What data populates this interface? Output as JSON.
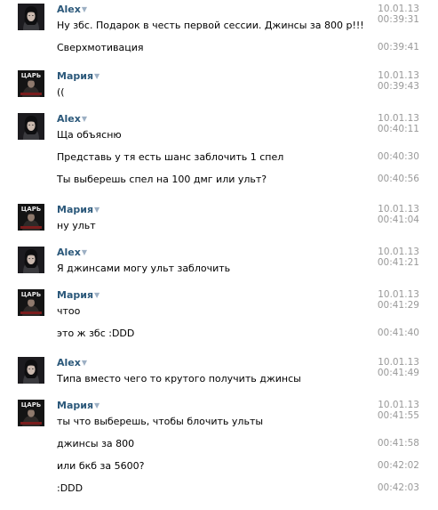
{
  "users": {
    "alex": "Alex",
    "maria": "Мария"
  },
  "avatars": {
    "maria_caption": "ЦАРЬ"
  },
  "colors": {
    "author_link": "#2b587a",
    "timestamp": "#999999"
  },
  "groups": [
    {
      "author": "Alex",
      "avatar": "alex",
      "date": "10.01.13",
      "lines": [
        {
          "text": "Ну збс. Подарок в честь первой сессии. Джинсы за 800 р!!!",
          "time": "00:39:31"
        },
        {
          "text": "Сверхмотивация",
          "time": "00:39:41"
        }
      ]
    },
    {
      "author": "Мария",
      "avatar": "maria",
      "date": "10.01.13",
      "lines": [
        {
          "text": "((",
          "time": "00:39:43"
        }
      ]
    },
    {
      "author": "Alex",
      "avatar": "alex",
      "date": "10.01.13",
      "lines": [
        {
          "text": "Ща объясню",
          "time": "00:40:11"
        },
        {
          "text": "Представь у тя есть шанс заблочить 1 спел",
          "time": "00:40:30"
        },
        {
          "text": "Ты выберешь спел на 100 дмг или ульт?",
          "time": "00:40:56"
        }
      ]
    },
    {
      "author": "Мария",
      "avatar": "maria",
      "date": "10.01.13",
      "lines": [
        {
          "text": "ну ульт",
          "time": "00:41:04"
        }
      ]
    },
    {
      "author": "Alex",
      "avatar": "alex",
      "date": "10.01.13",
      "lines": [
        {
          "text": "Я джинсами могу ульт заблочить",
          "time": "00:41:21"
        }
      ]
    },
    {
      "author": "Мария",
      "avatar": "maria",
      "date": "10.01.13",
      "lines": [
        {
          "text": "чтоо",
          "time": "00:41:29"
        },
        {
          "text": "это ж збс :DDD",
          "time": "00:41:40"
        }
      ]
    },
    {
      "author": "Alex",
      "avatar": "alex",
      "date": "10.01.13",
      "lines": [
        {
          "text": "Типа вместо чего то крутого получить джинсы",
          "time": "00:41:49"
        }
      ]
    },
    {
      "author": "Мария",
      "avatar": "maria",
      "date": "10.01.13",
      "lines": [
        {
          "text": "ты что выберешь, чтобы блочить ульты",
          "time": "00:41:55"
        },
        {
          "text": "джинсы за 800",
          "time": "00:41:58"
        },
        {
          "text": "или бкб за 5600?",
          "time": "00:42:02"
        },
        {
          "text": ":DDD",
          "time": "00:42:03"
        }
      ]
    }
  ]
}
